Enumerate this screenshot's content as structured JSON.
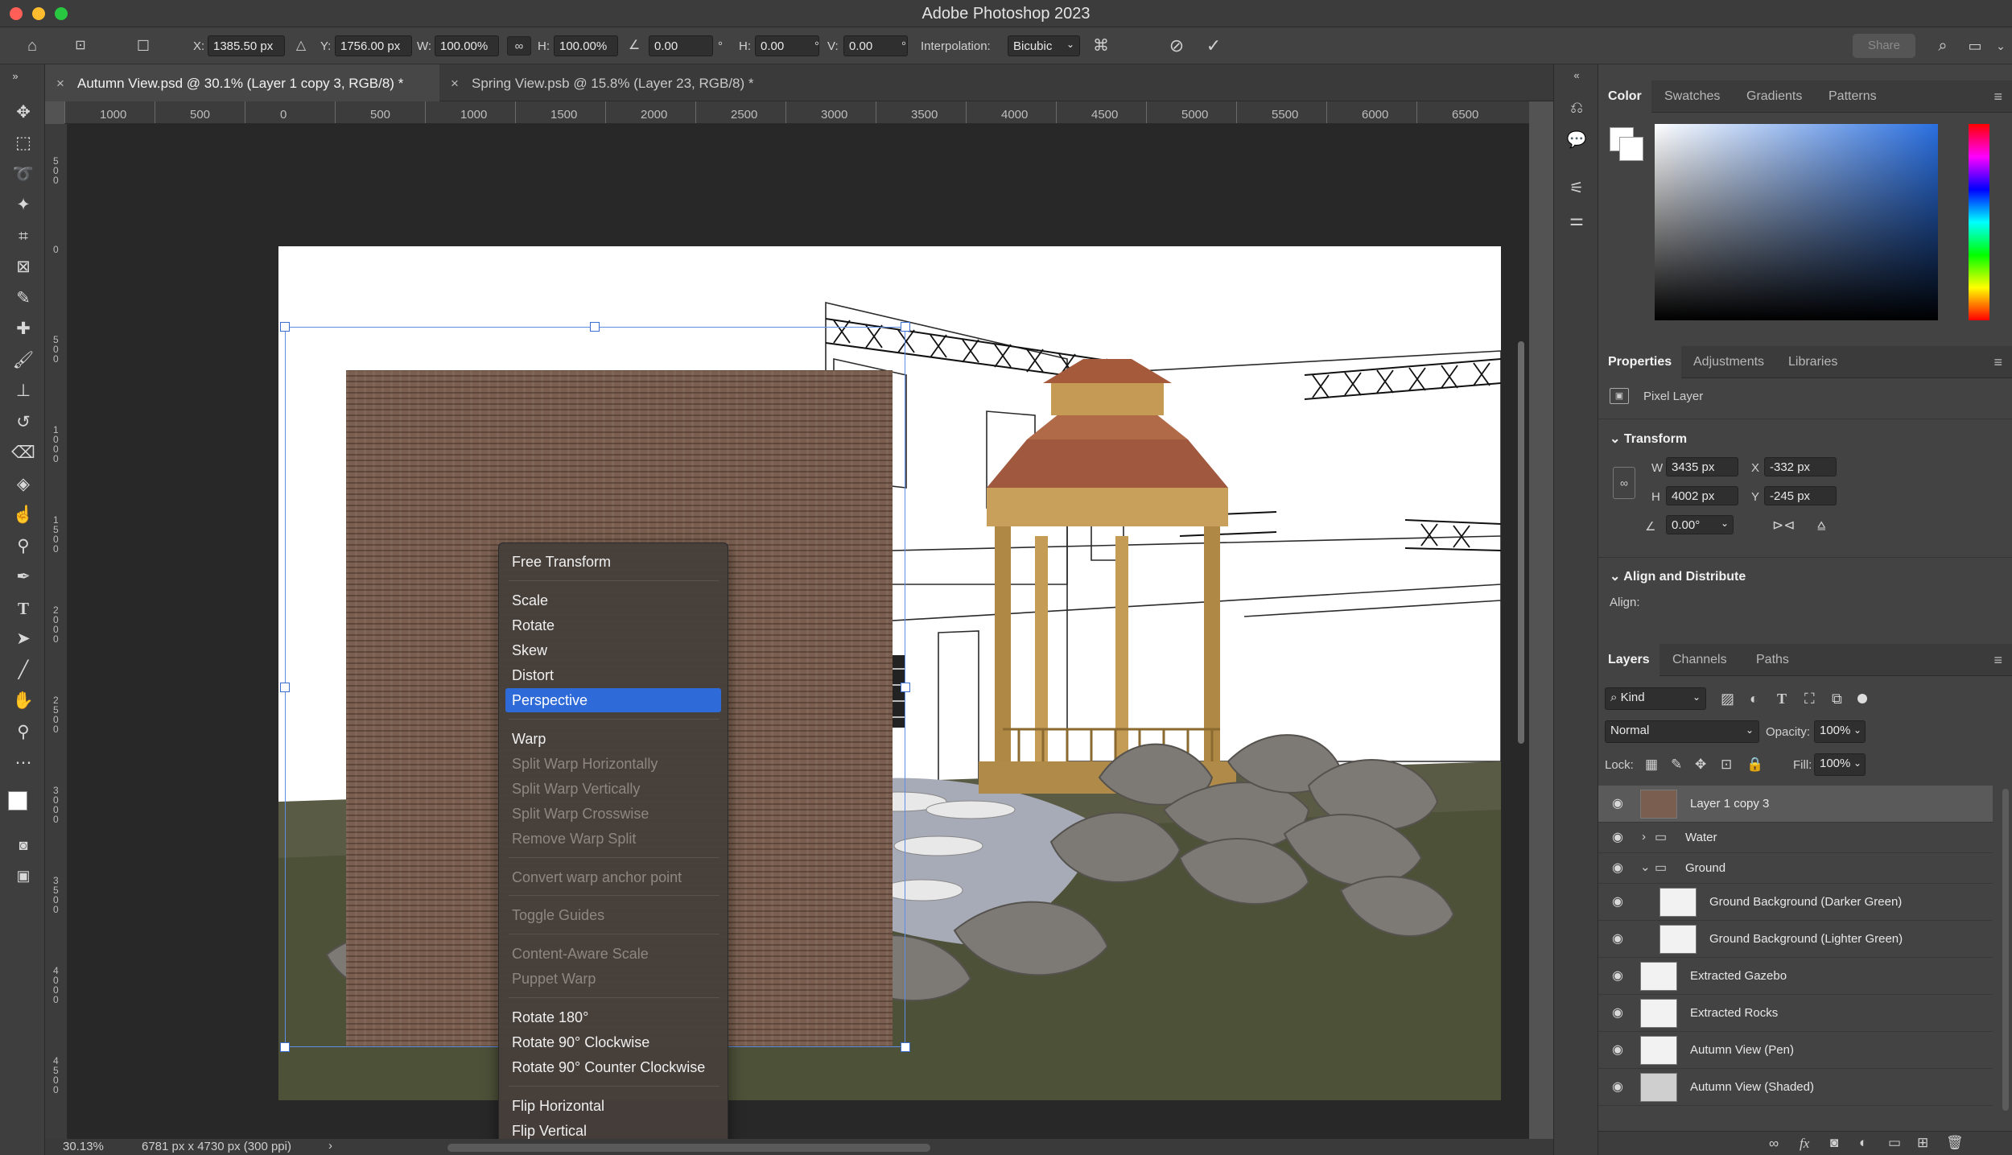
{
  "app": {
    "title": "Adobe Photoshop 2023"
  },
  "options": {
    "x_label": "X:",
    "x_value": "1385.50 px",
    "y_label": "Y:",
    "y_value": "1756.00 px",
    "w_label": "W:",
    "w_value": "100.00%",
    "h_label": "H:",
    "h_value": "100.00%",
    "angle_value": "0.00",
    "deg": "°",
    "hskew_label": "H:",
    "hskew_value": "0.00",
    "vskew_label": "V:",
    "vskew_value": "0.00",
    "interp_label": "Interpolation:",
    "interp_value": "Bicubic",
    "share_label": "Share"
  },
  "tabs": [
    {
      "label": "Autumn View.psd @ 30.1% (Layer 1 copy 3, RGB/8) *"
    },
    {
      "label": "Spring View.psb @ 15.8% (Layer 23, RGB/8) *"
    }
  ],
  "ruler": {
    "h": [
      "1000",
      "500",
      "0",
      "500",
      "1000",
      "1500",
      "2000",
      "2500",
      "3000",
      "3500",
      "4000",
      "4500",
      "5000",
      "5500",
      "6000",
      "6500"
    ],
    "v": [
      "500",
      "0",
      "500",
      "1000",
      "1500",
      "2000",
      "2500",
      "3000",
      "3500",
      "4000",
      "4500"
    ]
  },
  "context_menu": {
    "items": [
      {
        "label": "Free Transform"
      },
      {
        "label": "Scale"
      },
      {
        "label": "Rotate"
      },
      {
        "label": "Skew"
      },
      {
        "label": "Distort"
      },
      {
        "label": "Perspective"
      },
      {
        "label": "Warp"
      },
      {
        "label": "Split Warp Horizontally"
      },
      {
        "label": "Split Warp Vertically"
      },
      {
        "label": "Split Warp Crosswise"
      },
      {
        "label": "Remove Warp Split"
      },
      {
        "label": "Convert warp anchor point"
      },
      {
        "label": "Toggle Guides"
      },
      {
        "label": "Content-Aware Scale"
      },
      {
        "label": "Puppet Warp"
      },
      {
        "label": "Rotate 180°"
      },
      {
        "label": "Rotate 90° Clockwise"
      },
      {
        "label": "Rotate 90° Counter Clockwise"
      },
      {
        "label": "Flip Horizontal"
      },
      {
        "label": "Flip Vertical"
      }
    ],
    "selected": "Perspective"
  },
  "status": {
    "zoom": "30.13%",
    "doc_size": "6781 px x 4730 px (300 ppi)"
  },
  "color_panel": {
    "tabs": [
      "Color",
      "Swatches",
      "Gradients",
      "Patterns"
    ]
  },
  "properties_panel": {
    "tabs": [
      "Properties",
      "Adjustments",
      "Libraries"
    ],
    "kind": "Pixel Layer",
    "transform_title": "Transform",
    "w_label": "W",
    "w_value": "3435 px",
    "x_label": "X",
    "x_value": "-332 px",
    "h_label": "H",
    "h_value": "4002 px",
    "y_label": "Y",
    "y_value": "-245 px",
    "angle_value": "0.00°",
    "align_title": "Align and Distribute",
    "align_label": "Align:"
  },
  "layers_panel": {
    "tabs": [
      "Layers",
      "Channels",
      "Paths"
    ],
    "filter_label": "Kind",
    "blend_mode": "Normal",
    "opacity_label": "Opacity:",
    "opacity_value": "100%",
    "lock_label": "Lock:",
    "fill_label": "Fill:",
    "fill_value": "100%",
    "layers": [
      {
        "name": "Layer 1 copy 3"
      },
      {
        "name": "Water"
      },
      {
        "name": "Ground"
      },
      {
        "name": "Ground Background (Darker Green)"
      },
      {
        "name": "Ground Background (Lighter Green)"
      },
      {
        "name": "Extracted Gazebo"
      },
      {
        "name": "Extracted Rocks"
      },
      {
        "name": "Autumn View (Pen)"
      },
      {
        "name": "Autumn View (Shaded)"
      }
    ]
  },
  "colors": {
    "accent": "#2e6ad8",
    "transform_box": "#5c8ee6",
    "panel": "#434343"
  }
}
